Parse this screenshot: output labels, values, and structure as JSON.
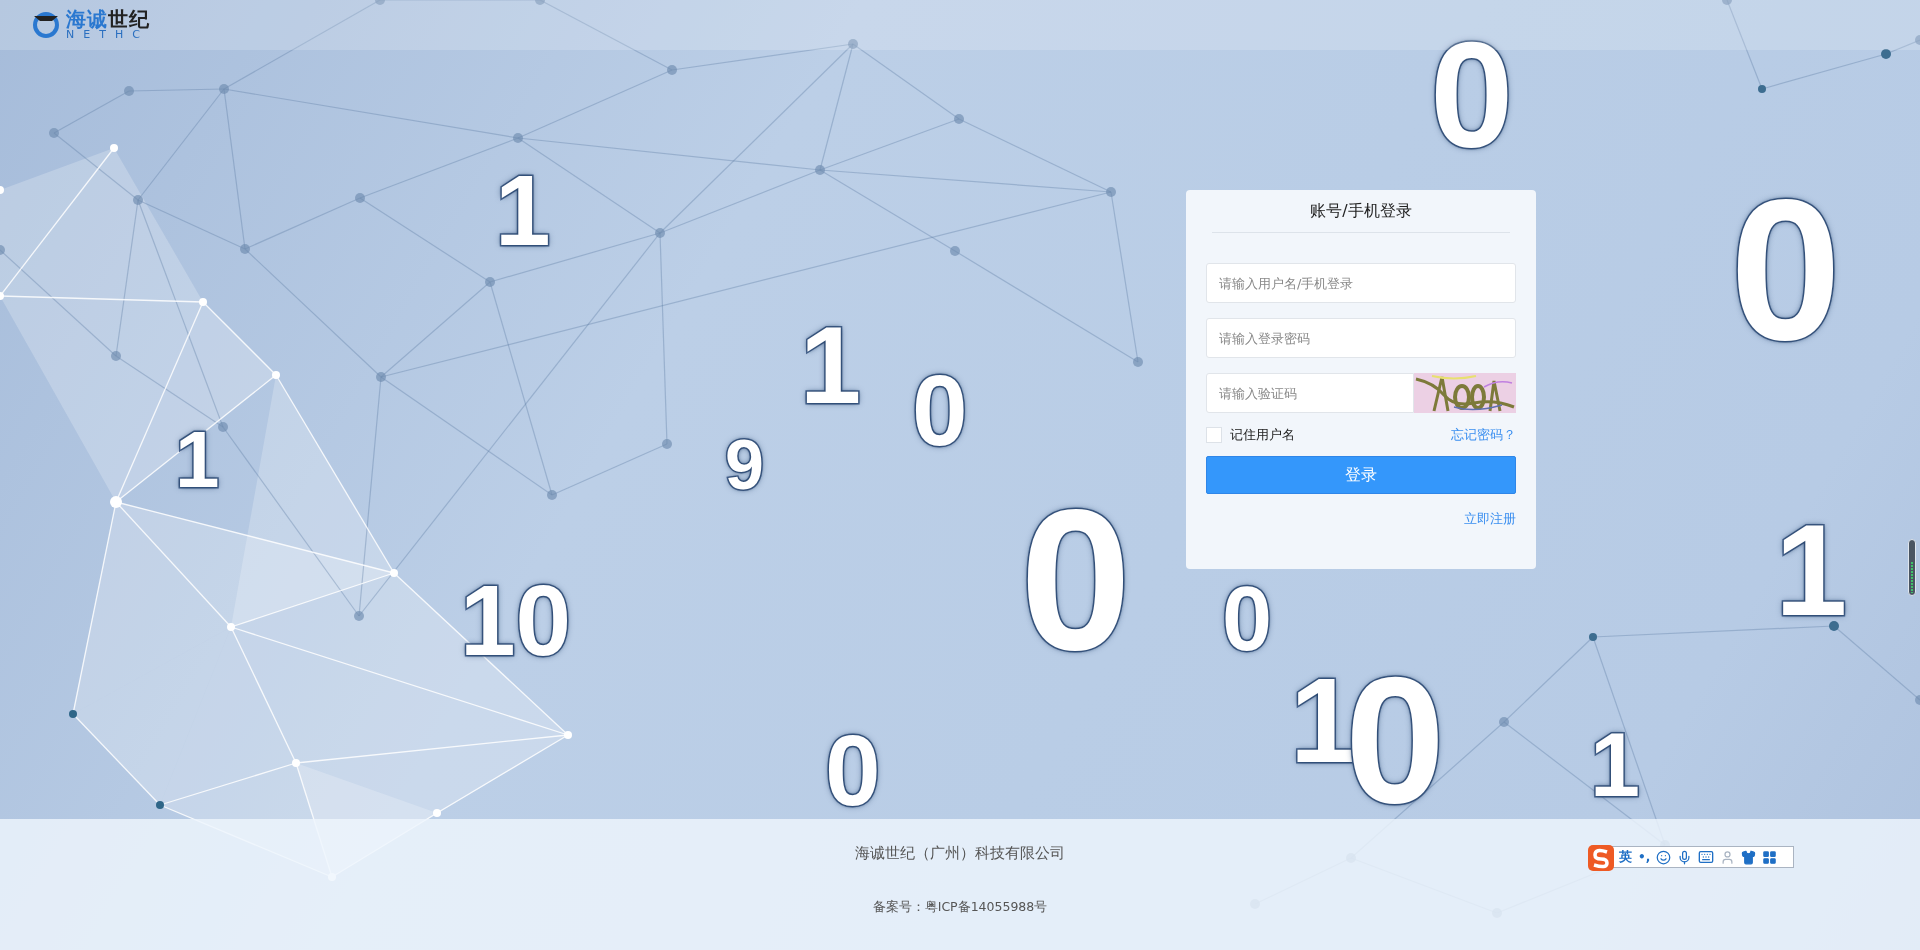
{
  "header": {
    "logo": {
      "name_parts": [
        "海诚",
        "世纪"
      ],
      "subtitle": "NETHC"
    }
  },
  "background_digits": [
    "0",
    "1",
    "1",
    "0",
    "0",
    "9",
    "1",
    "10",
    "0",
    "0",
    "1",
    "0",
    "1",
    "0",
    "1"
  ],
  "login": {
    "title": "账号/手机登录",
    "fields": [
      {
        "kind": "text",
        "placeholder": "请输入用户名/手机登录"
      },
      {
        "kind": "password",
        "placeholder": "请输入登录密码"
      },
      {
        "kind": "captcha",
        "placeholder": "请输入验证码"
      }
    ],
    "remember": {
      "label": "记住用户名",
      "checked": false
    },
    "forgot_link": "忘记密码？",
    "submit": "登录",
    "register_link": "立即注册"
  },
  "footer": {
    "company": "海诚世纪（广州）科技有限公司",
    "icp": "备案号：粤ICP备14055988号"
  },
  "ime_toolbar": {
    "mode": "英",
    "punct": "•,"
  },
  "volume_meter": {
    "level": 0.6
  }
}
